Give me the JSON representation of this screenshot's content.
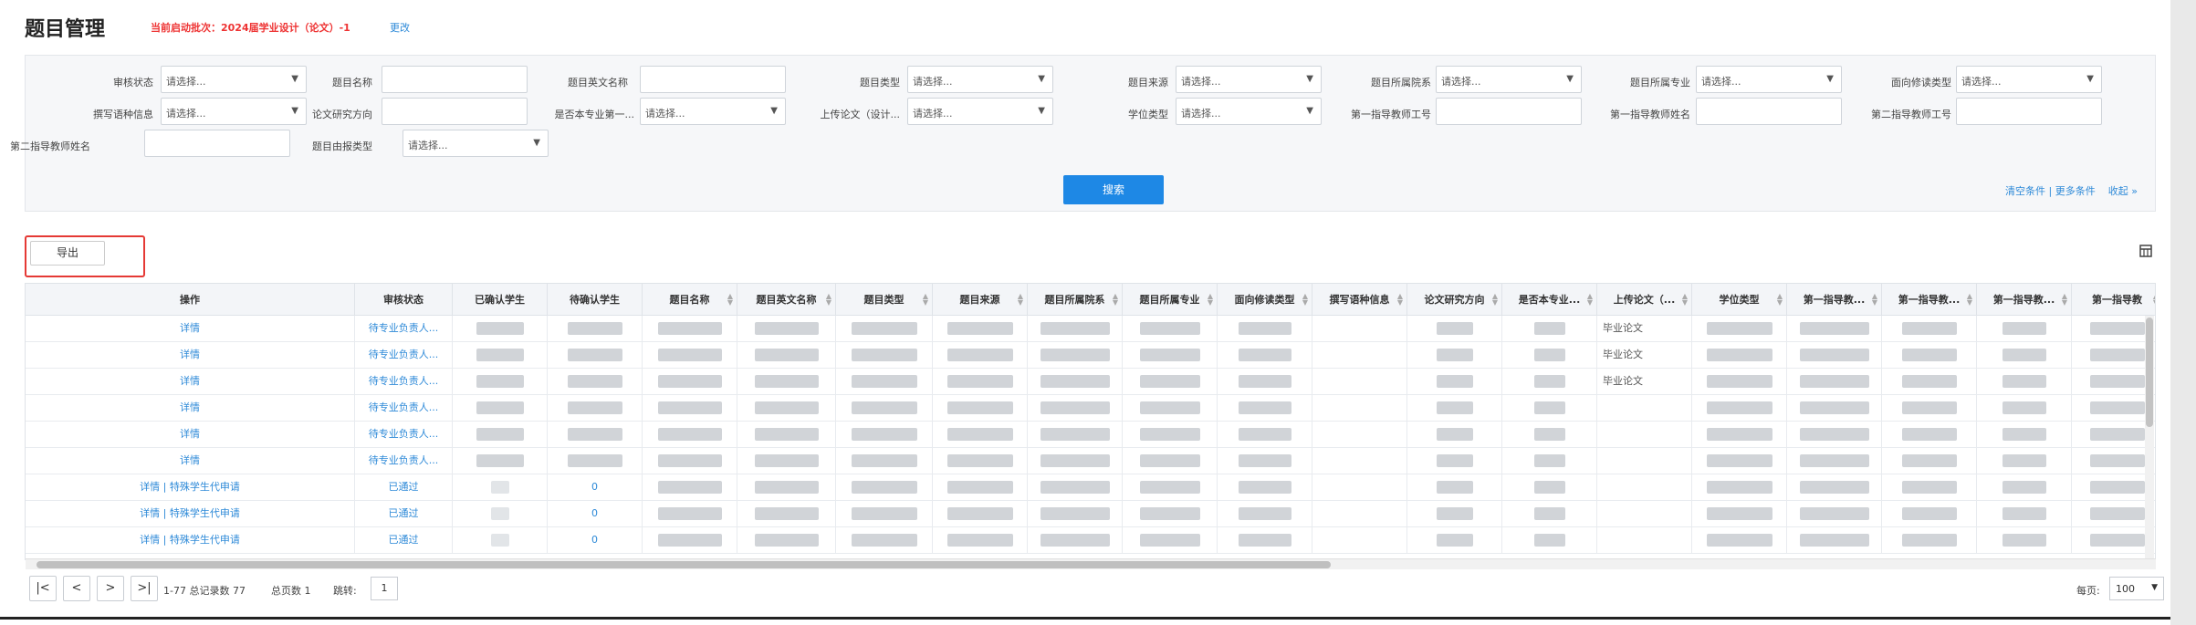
{
  "header": {
    "title": "题目管理",
    "batch": "当前启动批次：2024届学业设计（论文）-1",
    "change_link": "更改"
  },
  "filters": {
    "placeholder": "请选择...",
    "row1": [
      "审核状态",
      "题目名称",
      "题目英文名称",
      "题目类型",
      "题目来源",
      "题目所属院系",
      "题目所属专业",
      "面向修读类型"
    ],
    "row2": [
      "撰写语种信息",
      "论文研究方向",
      "是否本专业第一...",
      "上传论文（设计...",
      "学位类型",
      "第一指导教师工号",
      "第一指导教师姓名",
      "第二指导教师工号"
    ],
    "row3": [
      "第二指导教师姓名",
      "题目由报类型"
    ],
    "search_button": "搜索",
    "clear_link": "清空条件",
    "more_link": "更多条件",
    "collapse_link": "收起 »",
    "link_sep": "|"
  },
  "toolbar": {
    "export_button": "导出",
    "columns_icon": "column-settings-icon"
  },
  "table": {
    "columns": [
      "操作",
      "审核状态",
      "已确认学生",
      "待确认学生",
      "题目名称",
      "题目英文名称",
      "题目类型",
      "题目来源",
      "题目所属院系",
      "题目所属专业",
      "面向修读类型",
      "撰写语种信息",
      "论文研究方向",
      "是否本专业...",
      "上传论文（...",
      "学位类型",
      "第一指导教...",
      "第一指导教...",
      "第一指导教...",
      "第一指导教"
    ],
    "rows": [
      {
        "action": "详情",
        "status": "待专业负责人...",
        "upload": "毕业论文",
        "confirmed": "",
        "pending": ""
      },
      {
        "action": "详情",
        "status": "待专业负责人...",
        "upload": "毕业论文",
        "confirmed": "",
        "pending": ""
      },
      {
        "action": "详情",
        "status": "待专业负责人...",
        "upload": "毕业论文",
        "confirmed": "",
        "pending": ""
      },
      {
        "action": "详情",
        "status": "待专业负责人...",
        "upload": "",
        "confirmed": "",
        "pending": ""
      },
      {
        "action": "详情",
        "status": "待专业负责人...",
        "upload": "",
        "confirmed": "",
        "pending": ""
      },
      {
        "action": "详情",
        "status": "待专业负责人...",
        "upload": "",
        "confirmed": "",
        "pending": ""
      },
      {
        "action": "详情 | 特殊学生代申请",
        "status": "已通过",
        "upload": "",
        "confirmed": "",
        "pending": "0"
      },
      {
        "action": "详情 | 特殊学生代申请",
        "status": "已通过",
        "upload": "",
        "confirmed": "",
        "pending": "0"
      },
      {
        "action": "详情 | 特殊学生代申请",
        "status": "已通过",
        "upload": "",
        "confirmed": "",
        "pending": "0"
      }
    ]
  },
  "pager": {
    "first": "|<",
    "prev": "<",
    "next": ">",
    "last": ">|",
    "summary": "1-77 总记录数 77",
    "pages": "总页数 1",
    "jump_label": "跳转:",
    "jump_value": "1",
    "size_label": "每页:",
    "size_value": "100"
  }
}
